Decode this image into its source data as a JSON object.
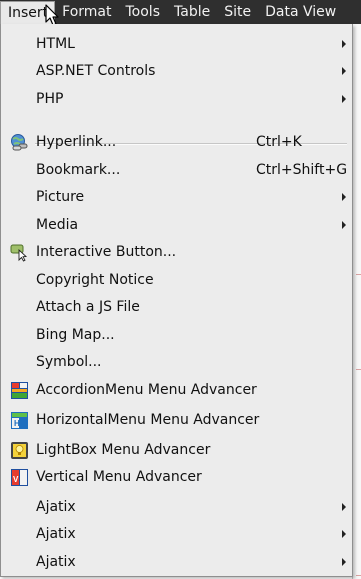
{
  "menubar": {
    "items": [
      "Insert",
      "Format",
      "Tools",
      "Table",
      "Site",
      "Data View"
    ]
  },
  "insert_menu": {
    "items": [
      {
        "label": "HTML",
        "submenu": true
      },
      {
        "label": "ASP.NET Controls",
        "submenu": true
      },
      {
        "label": "PHP",
        "submenu": true
      },
      {
        "label": "Hyperlink...",
        "shortcut": "Ctrl+K",
        "icon": "hyperlink-globe-icon"
      },
      {
        "label": "Bookmark...",
        "shortcut": "Ctrl+Shift+G"
      },
      {
        "label": "Picture",
        "submenu": true
      },
      {
        "label": "Media",
        "submenu": true
      },
      {
        "label": "Interactive Button...",
        "icon": "interactive-button-icon"
      },
      {
        "label": "Copyright Notice"
      },
      {
        "label": "Attach a JS File"
      },
      {
        "label": "Bing Map..."
      },
      {
        "label": "Symbol..."
      },
      {
        "label": "AccordionMenu Menu Advancer",
        "icon": "accordion-menu-icon"
      },
      {
        "label": "HorizontalMenu Menu Advancer",
        "icon": "horizontal-menu-icon"
      },
      {
        "label": "LightBox Menu Advancer",
        "icon": "lightbox-menu-icon"
      },
      {
        "label": "Vertical Menu Advancer",
        "icon": "vertical-menu-icon"
      },
      {
        "label": "Ajatix",
        "submenu": true
      },
      {
        "label": "Ajatix",
        "submenu": true
      },
      {
        "label": "Ajatix",
        "submenu": true
      }
    ]
  },
  "colors": {
    "menubar_bg": "#2f2f2f",
    "menu_bg": "#ececec"
  }
}
